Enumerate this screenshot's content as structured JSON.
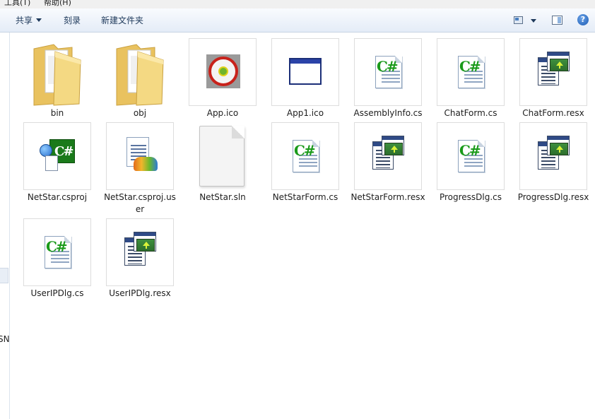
{
  "menubar": {
    "tools": "工具(T)",
    "help": "帮助(H)"
  },
  "toolbar": {
    "share": "共享",
    "burn": "刻录",
    "new_folder": "新建文件夹",
    "help_glyph": "?"
  },
  "nav": {
    "partial_text": "SN"
  },
  "files": [
    {
      "name": "bin",
      "type": "folder"
    },
    {
      "name": "obj",
      "type": "folder"
    },
    {
      "name": "App.ico",
      "type": "ico-stamp"
    },
    {
      "name": "App1.ico",
      "type": "ico-window"
    },
    {
      "name": "AssemblyInfo.cs",
      "type": "cs"
    },
    {
      "name": "ChatForm.cs",
      "type": "cs"
    },
    {
      "name": "ChatForm.resx",
      "type": "resx"
    },
    {
      "name": "NetStar.csproj",
      "type": "csproj"
    },
    {
      "name": "NetStar.csproj.user",
      "type": "csproj-user"
    },
    {
      "name": "NetStar.sln",
      "type": "sln"
    },
    {
      "name": "NetStarForm.cs",
      "type": "cs"
    },
    {
      "name": "NetStarForm.resx",
      "type": "resx"
    },
    {
      "name": "ProgressDlg.cs",
      "type": "cs"
    },
    {
      "name": "ProgressDlg.resx",
      "type": "resx"
    },
    {
      "name": "UserIPDlg.cs",
      "type": "cs"
    },
    {
      "name": "UserIPDlg.resx",
      "type": "resx"
    }
  ],
  "colors": {
    "cs_green": "#1a9a1a",
    "folder_yellow": "#f2d47a",
    "toolbar_text": "#1e395b"
  }
}
